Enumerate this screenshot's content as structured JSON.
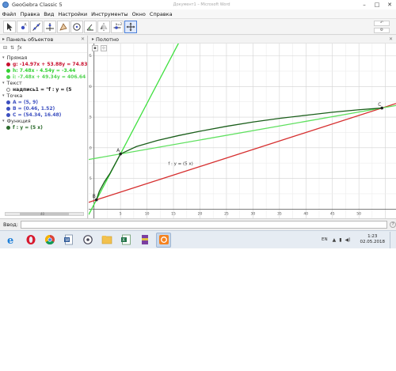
{
  "window": {
    "title": "GeoGebra Classic 5",
    "ghost_title": "Документ1 – Microsoft Word",
    "minimize": "–",
    "maximize": "□",
    "close": "✕"
  },
  "menu": [
    "Файл",
    "Правка",
    "Вид",
    "Настройки",
    "Инструменты",
    "Окно",
    "Справка"
  ],
  "toolbar": {
    "tools": [
      "move-tool",
      "point-tool",
      "line-tool",
      "perpendicular-tool",
      "polygon-tool",
      "circle-tool",
      "angle-tool",
      "reflect-tool",
      "slider-tool",
      "move-graphics-tool"
    ],
    "undo": "↶",
    "settings": "⚙"
  },
  "algebra": {
    "header": "Панель объектов",
    "close": "✕",
    "groups": [
      {
        "name": "Прямая",
        "items": [
          {
            "text": "g: -14.97x + 53.88y = 74.83",
            "color": "#c8102e"
          },
          {
            "text": "h: 7.48x - 4.54y = -3.44",
            "color": "#2fd12f"
          },
          {
            "text": "i: -7.48x + 49.34y = 406.64",
            "color": "#52d452"
          }
        ]
      },
      {
        "name": "Текст",
        "items": [
          {
            "text": "надпись1 = \"f : y = (5",
            "color": "hidden"
          }
        ]
      },
      {
        "name": "Точка",
        "items": [
          {
            "text": "A = (5, 9)",
            "color": "#3c4fc0"
          },
          {
            "text": "B = (0.46, 1.52)",
            "color": "#3c4fc0"
          },
          {
            "text": "C = (54.34, 16.48)",
            "color": "#3c4fc0"
          }
        ]
      },
      {
        "name": "Функция",
        "items": [
          {
            "text": "f : y = (5 x)",
            "color": "#2b6a2b"
          }
        ]
      }
    ],
    "scroll_label": "40"
  },
  "graphics": {
    "header": "Полотно",
    "close": "✕"
  },
  "input": {
    "label": "Ввод:",
    "help": "?"
  },
  "taskbar": {
    "apps": [
      "ie-icon",
      "opera-icon",
      "chrome-icon",
      "word-doc-icon",
      "settings-app-icon",
      "folder-icon",
      "excel-icon",
      "winrar-icon",
      "geogebra-icon"
    ],
    "lang": "EN",
    "time": "1:23",
    "date": "02.05.2018"
  },
  "chart_data": {
    "type": "line",
    "xlim": [
      -1,
      57
    ],
    "ylim": [
      -1.5,
      27
    ],
    "x_ticks": [
      5,
      10,
      15,
      20,
      25,
      30,
      35,
      40,
      45,
      50
    ],
    "y_ticks": [
      5,
      10,
      15,
      20,
      25
    ],
    "grid": true,
    "series": [
      {
        "name": "g",
        "kind": "line",
        "equation": "-14.97x + 53.88y = 74.83",
        "color": "#d62f2f",
        "x": [
          -1,
          57
        ],
        "y": [
          1.11,
          17.22
        ]
      },
      {
        "name": "h",
        "kind": "line",
        "equation": "7.48x - 4.54y = -3.44",
        "color": "#3fe03f",
        "x": [
          -1,
          16
        ],
        "y": [
          -0.89,
          27.12
        ]
      },
      {
        "name": "i",
        "kind": "line",
        "equation": "-7.48x + 49.34y = 406.64",
        "color": "#5fe05f",
        "x": [
          -1,
          57
        ],
        "y": [
          8.09,
          16.89
        ]
      },
      {
        "name": "f",
        "kind": "function",
        "color": "#1a5e1a",
        "x": [
          0.46,
          1,
          2,
          3,
          5,
          8,
          12,
          16,
          20,
          25,
          30,
          35,
          40,
          45,
          50,
          54.34
        ],
        "y": [
          1.52,
          2.9,
          4.5,
          5.8,
          9.0,
          10.2,
          11.2,
          12.0,
          12.7,
          13.5,
          14.2,
          14.8,
          15.3,
          15.8,
          16.2,
          16.48
        ]
      }
    ],
    "points": [
      {
        "name": "A",
        "x": 5,
        "y": 9
      },
      {
        "name": "B",
        "x": 0.46,
        "y": 1.52
      },
      {
        "name": "C",
        "x": 54.34,
        "y": 16.48
      }
    ],
    "annotation": {
      "text": "f : y = (5 x)",
      "x": 14,
      "y": 7.2
    }
  }
}
